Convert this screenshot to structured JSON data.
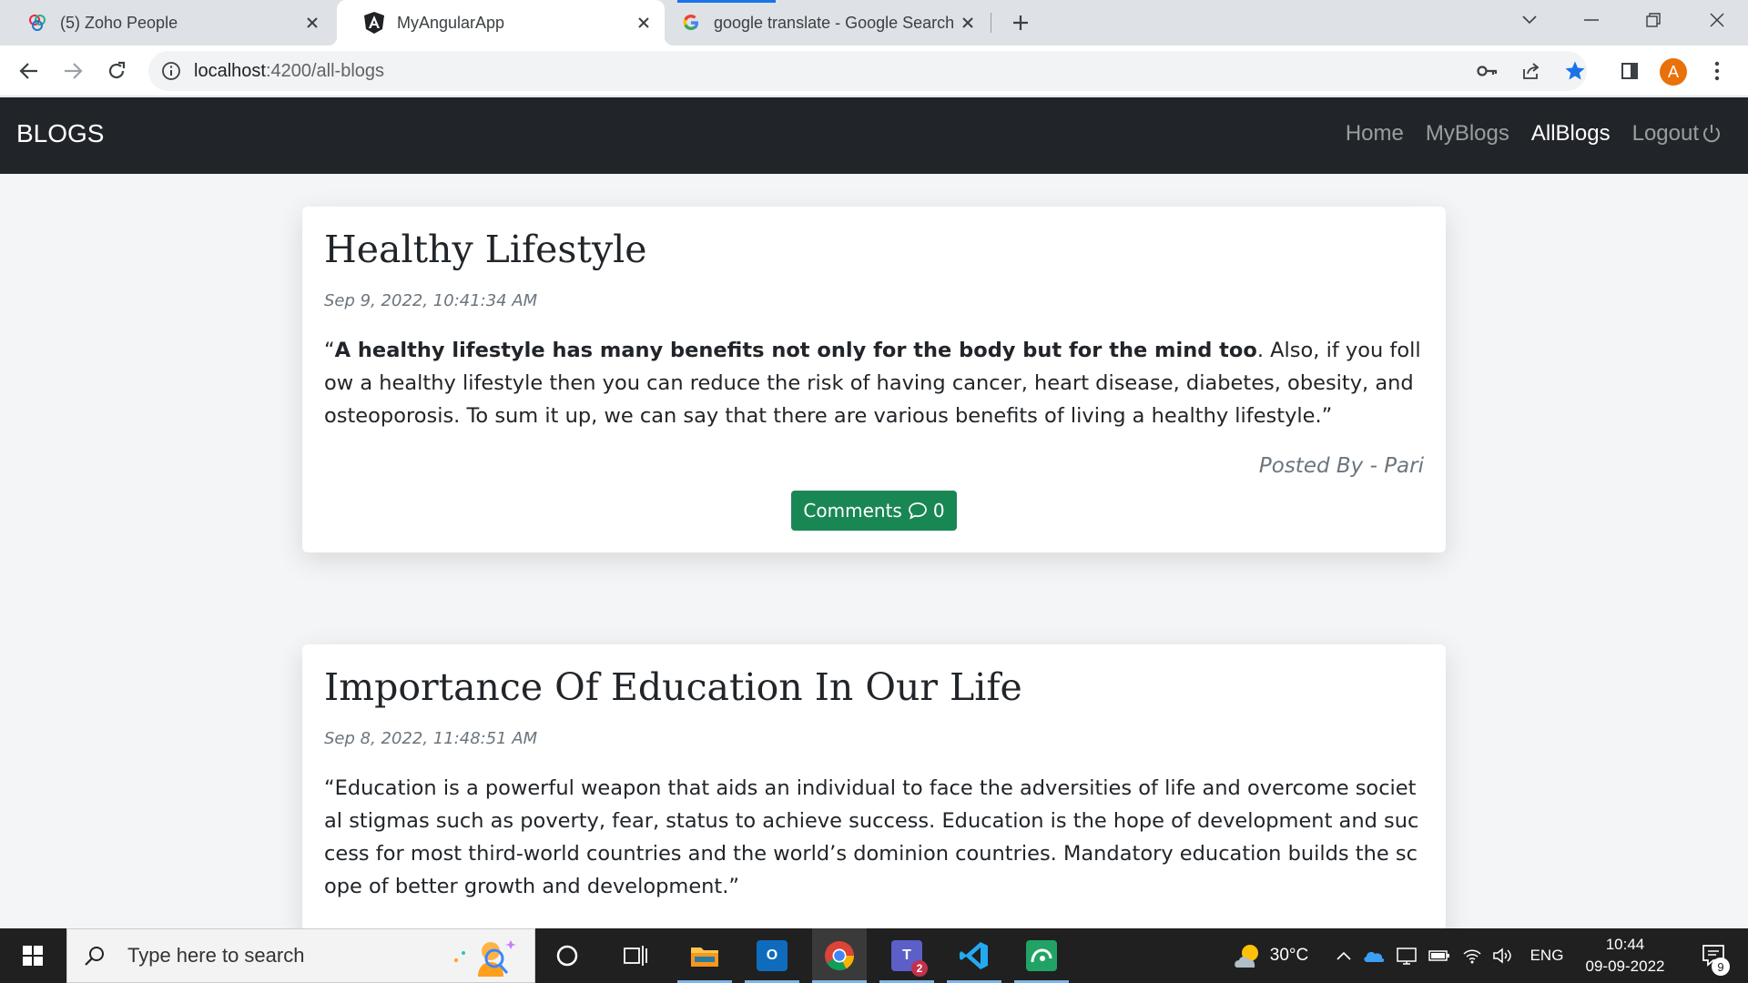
{
  "browser": {
    "tabs": [
      {
        "title": "(5) Zoho People",
        "active": false
      },
      {
        "title": "MyAngularApp",
        "active": true
      },
      {
        "title": "google translate - Google Search",
        "active": false
      }
    ],
    "url_host": "localhost",
    "url_path": ":4200/all-blogs",
    "profile_initial": "A"
  },
  "navbar": {
    "brand": "BLOGS",
    "links": [
      {
        "label": "Home"
      },
      {
        "label": "MyBlogs"
      },
      {
        "label": "AllBlogs"
      },
      {
        "label": "Logout"
      }
    ]
  },
  "posts": [
    {
      "title": "Healthy Lifestyle",
      "date": "Sep 9, 2022, 10:41:34 AM",
      "body_prefix": "“",
      "body_bold": "A healthy lifestyle has many benefits not only for the body but for the mind too",
      "body_rest": ". Also, if you follow a healthy lifestyle then you can reduce the risk of having cancer, heart disease, diabetes, obesity, and osteoporosis. To sum it up, we can say that there are various benefits of living a healthy lifestyle.”",
      "author": "Posted By - Pari",
      "comments_label": "Comments",
      "comments_count": "0"
    },
    {
      "title": "Importance Of Education In Our Life",
      "date": "Sep 8, 2022, 11:48:51 AM",
      "body": "“Education is a powerful weapon that aids an individual to face the adversities of life and overcome societal stigmas such as poverty, fear, status to achieve success. Education is the hope of development and success for most third-world countries and the world’s dominion countries. Mandatory education builds the scope of better growth and development.”"
    }
  ],
  "taskbar": {
    "search_placeholder": "Type here to search",
    "weather": "30°C",
    "language": "ENG",
    "time": "10:44",
    "date": "09-09-2022",
    "notification_count": "9",
    "teams_badge": "2"
  }
}
